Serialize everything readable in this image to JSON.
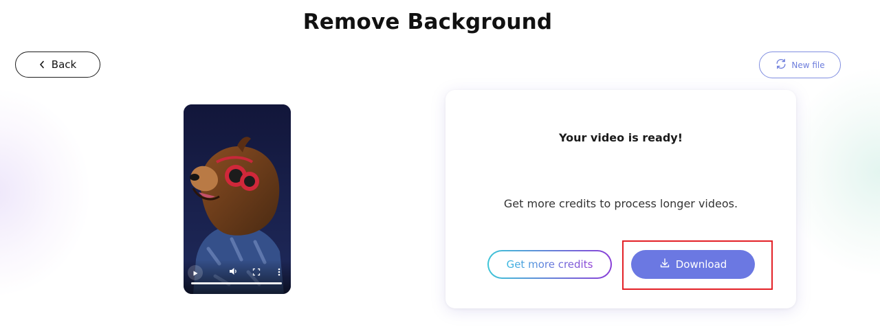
{
  "header": {
    "title": "Remove Background"
  },
  "nav": {
    "back_label": "Back",
    "new_file_label": "New file"
  },
  "video": {
    "progress": 1.0
  },
  "result_card": {
    "heading": "Your video is ready!",
    "message": "Get more credits to process longer videos.",
    "get_credits_label": "Get more credits",
    "download_label": "Download"
  },
  "colors": {
    "accent": "#6b78e2",
    "new_file_border": "#7f8de0",
    "gradient_start": "#3ec6d8",
    "gradient_end": "#8a3fd8",
    "highlight": "#e32026",
    "video_background": "#171c44"
  },
  "icons": {
    "back": "chevron-left-icon",
    "new_file": "refresh-icon",
    "download": "download-icon",
    "play": "play-icon",
    "volume": "volume-icon",
    "fullscreen": "fullscreen-icon",
    "more": "more-vertical-icon"
  }
}
